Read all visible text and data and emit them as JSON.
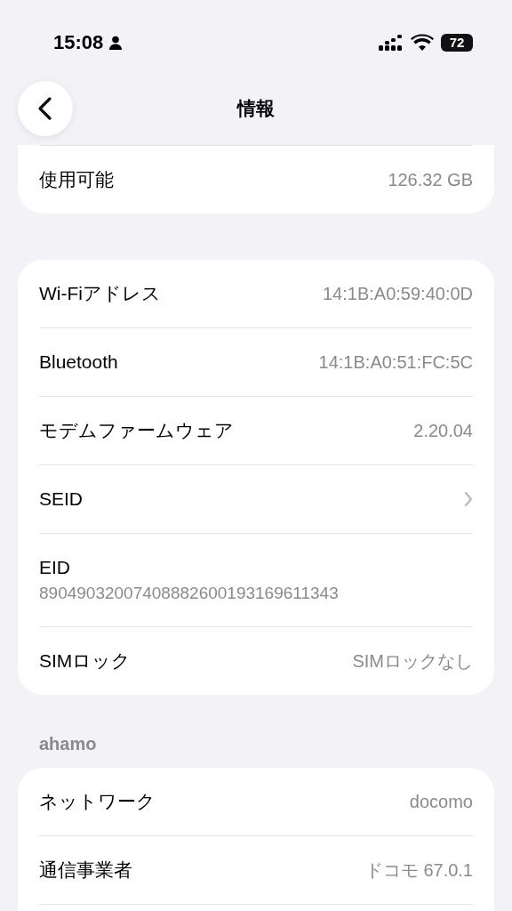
{
  "status_bar": {
    "time": "15:08",
    "battery": "72"
  },
  "nav": {
    "title": "情報"
  },
  "groups": [
    {
      "clipped_top": true,
      "clipped_bottom": false,
      "rows": [
        {
          "kind": "value",
          "label": "使用可能",
          "value": "126.32 GB"
        }
      ]
    },
    {
      "clipped_top": false,
      "clipped_bottom": false,
      "rows": [
        {
          "kind": "value",
          "label": "Wi-Fiアドレス",
          "value": "14:1B:A0:59:40:0D"
        },
        {
          "kind": "value",
          "label": "Bluetooth",
          "value": "14:1B:A0:51:FC:5C"
        },
        {
          "kind": "value",
          "label": "モデムファームウェア",
          "value": "2.20.04"
        },
        {
          "kind": "link",
          "label": "SEID"
        },
        {
          "kind": "stacked",
          "label": "EID",
          "value": "89049032007408882600193169611343"
        },
        {
          "kind": "value",
          "label": "SIMロック",
          "value": "SIMロックなし"
        }
      ]
    },
    {
      "header": "ahamo",
      "clipped_top": false,
      "clipped_bottom": true,
      "rows": [
        {
          "kind": "value",
          "label": "ネットワーク",
          "value": "docomo"
        },
        {
          "kind": "value",
          "label": "通信事業者",
          "value": "ドコモ 67.0.1"
        }
      ]
    }
  ]
}
